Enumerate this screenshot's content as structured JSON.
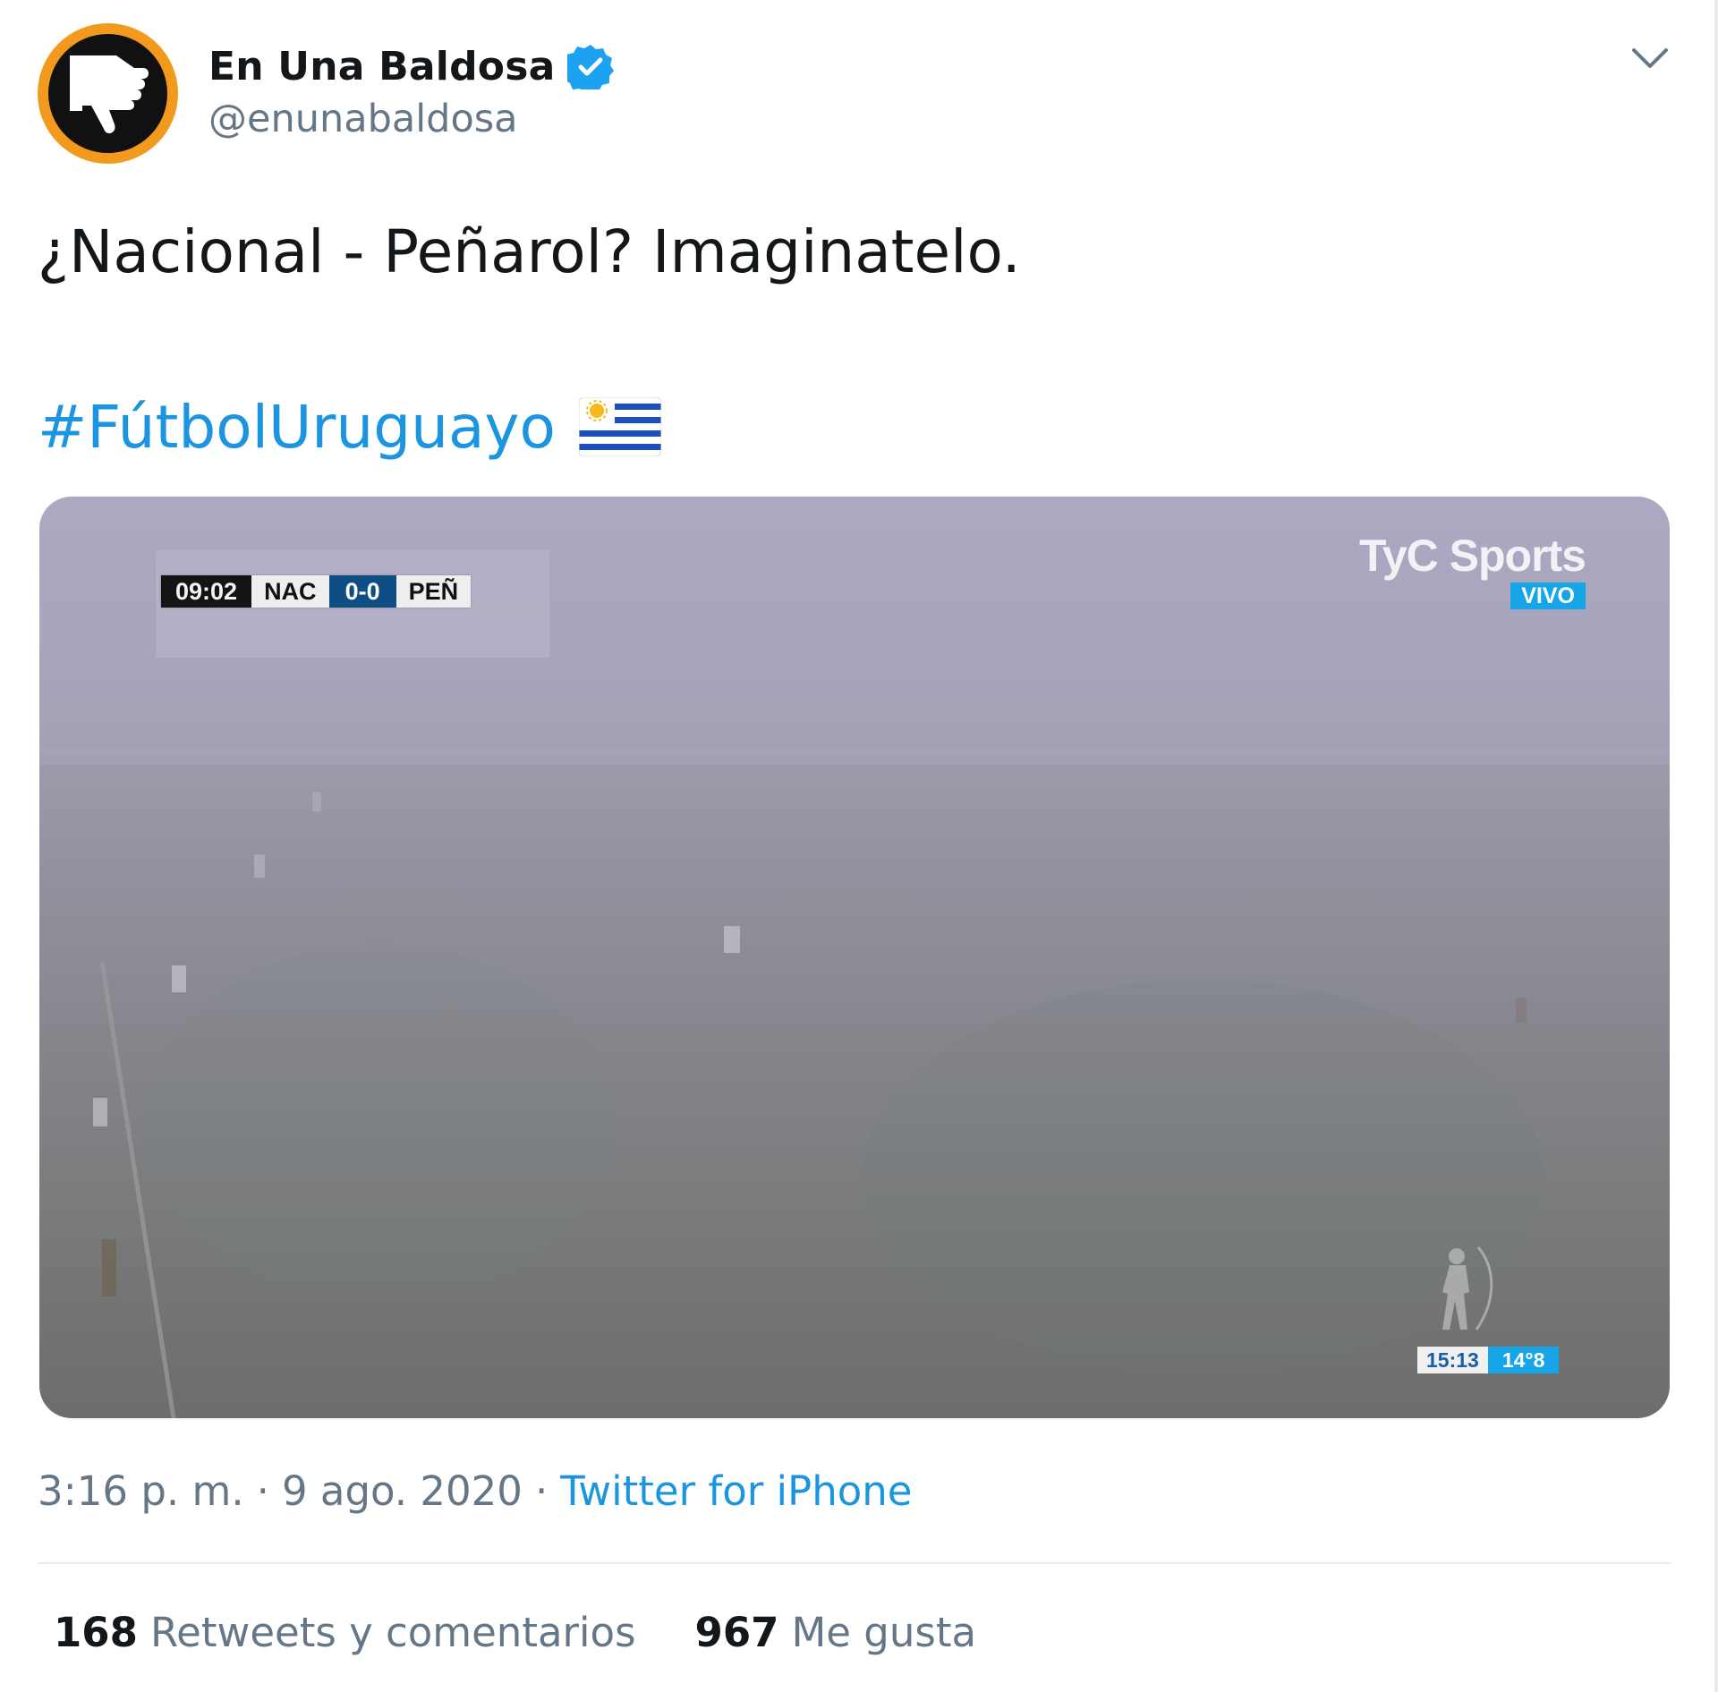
{
  "header": {
    "display_name": "En Una Baldosa",
    "handle": "@enunabaldosa",
    "verified": true,
    "avatar_icon": "thumbs-down-icon",
    "colors": {
      "avatar_ring": "#f29a1d",
      "verified": "#1da1f2"
    }
  },
  "tweet": {
    "text": "¿Nacional - Peñarol? Imaginatelo.",
    "hashtag": "#FútbolUruguayo",
    "flag_icon": "uruguay-flag-icon"
  },
  "media": {
    "scorebug": {
      "time": "09:02",
      "home": "NAC",
      "score": "0-0",
      "away": "PEÑ"
    },
    "broadcaster": {
      "name": "TyC Sports",
      "live_label": "VIVO"
    },
    "clock": {
      "time": "15:13",
      "temperature": "14°8"
    }
  },
  "meta": {
    "time": "3:16 p. m.",
    "separator": "·",
    "date": "9 ago. 2020",
    "source": "Twitter for iPhone"
  },
  "stats": {
    "retweets_count": "168",
    "retweets_label": "Retweets y comentarios",
    "likes_count": "967",
    "likes_label": "Me gusta"
  },
  "colors": {
    "text": "#14171a",
    "secondary": "#657786",
    "link": "#1b95e0",
    "divider": "#e6ecf0"
  }
}
